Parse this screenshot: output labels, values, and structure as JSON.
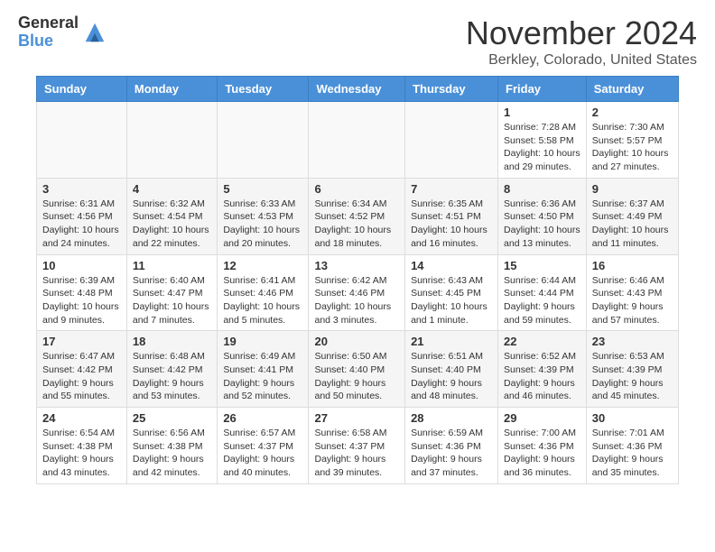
{
  "header": {
    "logo_general": "General",
    "logo_blue": "Blue",
    "month_title": "November 2024",
    "location": "Berkley, Colorado, United States"
  },
  "days_of_week": [
    "Sunday",
    "Monday",
    "Tuesday",
    "Wednesday",
    "Thursday",
    "Friday",
    "Saturday"
  ],
  "weeks": [
    [
      {
        "day": "",
        "info": ""
      },
      {
        "day": "",
        "info": ""
      },
      {
        "day": "",
        "info": ""
      },
      {
        "day": "",
        "info": ""
      },
      {
        "day": "",
        "info": ""
      },
      {
        "day": "1",
        "info": "Sunrise: 7:28 AM\nSunset: 5:58 PM\nDaylight: 10 hours and 29 minutes."
      },
      {
        "day": "2",
        "info": "Sunrise: 7:30 AM\nSunset: 5:57 PM\nDaylight: 10 hours and 27 minutes."
      }
    ],
    [
      {
        "day": "3",
        "info": "Sunrise: 6:31 AM\nSunset: 4:56 PM\nDaylight: 10 hours and 24 minutes."
      },
      {
        "day": "4",
        "info": "Sunrise: 6:32 AM\nSunset: 4:54 PM\nDaylight: 10 hours and 22 minutes."
      },
      {
        "day": "5",
        "info": "Sunrise: 6:33 AM\nSunset: 4:53 PM\nDaylight: 10 hours and 20 minutes."
      },
      {
        "day": "6",
        "info": "Sunrise: 6:34 AM\nSunset: 4:52 PM\nDaylight: 10 hours and 18 minutes."
      },
      {
        "day": "7",
        "info": "Sunrise: 6:35 AM\nSunset: 4:51 PM\nDaylight: 10 hours and 16 minutes."
      },
      {
        "day": "8",
        "info": "Sunrise: 6:36 AM\nSunset: 4:50 PM\nDaylight: 10 hours and 13 minutes."
      },
      {
        "day": "9",
        "info": "Sunrise: 6:37 AM\nSunset: 4:49 PM\nDaylight: 10 hours and 11 minutes."
      }
    ],
    [
      {
        "day": "10",
        "info": "Sunrise: 6:39 AM\nSunset: 4:48 PM\nDaylight: 10 hours and 9 minutes."
      },
      {
        "day": "11",
        "info": "Sunrise: 6:40 AM\nSunset: 4:47 PM\nDaylight: 10 hours and 7 minutes."
      },
      {
        "day": "12",
        "info": "Sunrise: 6:41 AM\nSunset: 4:46 PM\nDaylight: 10 hours and 5 minutes."
      },
      {
        "day": "13",
        "info": "Sunrise: 6:42 AM\nSunset: 4:46 PM\nDaylight: 10 hours and 3 minutes."
      },
      {
        "day": "14",
        "info": "Sunrise: 6:43 AM\nSunset: 4:45 PM\nDaylight: 10 hours and 1 minute."
      },
      {
        "day": "15",
        "info": "Sunrise: 6:44 AM\nSunset: 4:44 PM\nDaylight: 9 hours and 59 minutes."
      },
      {
        "day": "16",
        "info": "Sunrise: 6:46 AM\nSunset: 4:43 PM\nDaylight: 9 hours and 57 minutes."
      }
    ],
    [
      {
        "day": "17",
        "info": "Sunrise: 6:47 AM\nSunset: 4:42 PM\nDaylight: 9 hours and 55 minutes."
      },
      {
        "day": "18",
        "info": "Sunrise: 6:48 AM\nSunset: 4:42 PM\nDaylight: 9 hours and 53 minutes."
      },
      {
        "day": "19",
        "info": "Sunrise: 6:49 AM\nSunset: 4:41 PM\nDaylight: 9 hours and 52 minutes."
      },
      {
        "day": "20",
        "info": "Sunrise: 6:50 AM\nSunset: 4:40 PM\nDaylight: 9 hours and 50 minutes."
      },
      {
        "day": "21",
        "info": "Sunrise: 6:51 AM\nSunset: 4:40 PM\nDaylight: 9 hours and 48 minutes."
      },
      {
        "day": "22",
        "info": "Sunrise: 6:52 AM\nSunset: 4:39 PM\nDaylight: 9 hours and 46 minutes."
      },
      {
        "day": "23",
        "info": "Sunrise: 6:53 AM\nSunset: 4:39 PM\nDaylight: 9 hours and 45 minutes."
      }
    ],
    [
      {
        "day": "24",
        "info": "Sunrise: 6:54 AM\nSunset: 4:38 PM\nDaylight: 9 hours and 43 minutes."
      },
      {
        "day": "25",
        "info": "Sunrise: 6:56 AM\nSunset: 4:38 PM\nDaylight: 9 hours and 42 minutes."
      },
      {
        "day": "26",
        "info": "Sunrise: 6:57 AM\nSunset: 4:37 PM\nDaylight: 9 hours and 40 minutes."
      },
      {
        "day": "27",
        "info": "Sunrise: 6:58 AM\nSunset: 4:37 PM\nDaylight: 9 hours and 39 minutes."
      },
      {
        "day": "28",
        "info": "Sunrise: 6:59 AM\nSunset: 4:36 PM\nDaylight: 9 hours and 37 minutes."
      },
      {
        "day": "29",
        "info": "Sunrise: 7:00 AM\nSunset: 4:36 PM\nDaylight: 9 hours and 36 minutes."
      },
      {
        "day": "30",
        "info": "Sunrise: 7:01 AM\nSunset: 4:36 PM\nDaylight: 9 hours and 35 minutes."
      }
    ]
  ]
}
